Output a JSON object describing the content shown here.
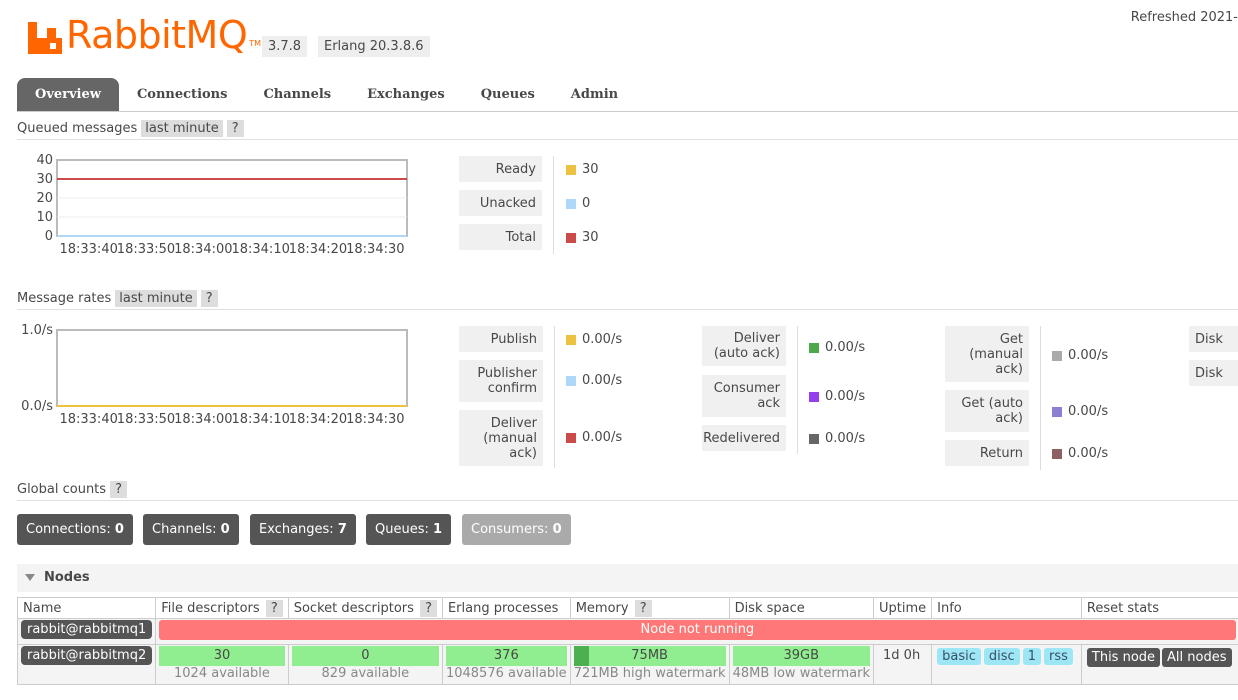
{
  "header": {
    "logo_text": "RabbitMQ",
    "logo_tm": "TM",
    "version": "3.7.8",
    "erlang": "Erlang 20.3.8.6",
    "refreshed": "Refreshed 2021-"
  },
  "tabs": [
    "Overview",
    "Connections",
    "Channels",
    "Exchanges",
    "Queues",
    "Admin"
  ],
  "queued": {
    "title": "Queued messages",
    "range": "last minute",
    "help": "?",
    "legend": [
      {
        "label": "Ready",
        "value": "30",
        "color": "#edc240"
      },
      {
        "label": "Unacked",
        "value": "0",
        "color": "#afd8f8"
      },
      {
        "label": "Total",
        "value": "30",
        "color": "#cb4b4b"
      }
    ]
  },
  "rates": {
    "title": "Message rates",
    "range": "last minute",
    "help": "?",
    "col1": [
      {
        "label": "Publish",
        "value": "0.00/s",
        "color": "#edc240"
      },
      {
        "label": "Publisher confirm",
        "value": "0.00/s",
        "color": "#afd8f8"
      },
      {
        "label": "Deliver (manual ack)",
        "value": "0.00/s",
        "color": "#cb4b4b"
      }
    ],
    "col2": [
      {
        "label": "Deliver (auto ack)",
        "value": "0.00/s",
        "color": "#4da74d"
      },
      {
        "label": "Consumer ack",
        "value": "0.00/s",
        "color": "#9440ed"
      },
      {
        "label": "Redelivered",
        "value": "0.00/s",
        "color": "#666666"
      }
    ],
    "col3": [
      {
        "label": "Get (manual ack)",
        "value": "0.00/s",
        "color": "#aaaaaa"
      },
      {
        "label": "Get (auto ack)",
        "value": "0.00/s",
        "color": "#8a7fd0"
      },
      {
        "label": "Return",
        "value": "0.00/s",
        "color": "#8c6161"
      }
    ],
    "col4": [
      "Disk",
      "Disk"
    ]
  },
  "chart_data": [
    {
      "type": "line",
      "title": "Queued messages",
      "x": [
        "18:33:40",
        "18:33:50",
        "18:34:00",
        "18:34:10",
        "18:34:20",
        "18:34:30"
      ],
      "y_ticks": [
        "40",
        "30",
        "20",
        "10",
        "0"
      ],
      "ylim": [
        0,
        40
      ],
      "series": [
        {
          "name": "Ready",
          "values": [
            30,
            30,
            30,
            30,
            30,
            30
          ]
        },
        {
          "name": "Unacked",
          "values": [
            0,
            0,
            0,
            0,
            0,
            0
          ]
        },
        {
          "name": "Total",
          "values": [
            30,
            30,
            30,
            30,
            30,
            30
          ]
        }
      ]
    },
    {
      "type": "line",
      "title": "Message rates",
      "x": [
        "18:33:40",
        "18:33:50",
        "18:34:00",
        "18:34:10",
        "18:34:20",
        "18:34:30"
      ],
      "y_ticks": [
        "1.0/s",
        "0.0/s"
      ],
      "ylim": [
        0,
        1
      ],
      "series": [
        {
          "name": "Publish",
          "values": [
            0,
            0,
            0,
            0,
            0,
            0
          ]
        }
      ]
    }
  ],
  "global": {
    "title": "Global counts",
    "help": "?",
    "counts": [
      {
        "label": "Connections:",
        "value": "0"
      },
      {
        "label": "Channels:",
        "value": "0"
      },
      {
        "label": "Exchanges:",
        "value": "7"
      },
      {
        "label": "Queues:",
        "value": "1"
      },
      {
        "label": "Consumers:",
        "value": "0"
      }
    ]
  },
  "nodes": {
    "title": "Nodes",
    "columns": [
      "Name",
      "File descriptors",
      "Socket descriptors",
      "Erlang processes",
      "Memory",
      "Disk space",
      "Uptime",
      "Info",
      "Reset stats"
    ],
    "help": "?",
    "rows": [
      {
        "name": "rabbit@rabbitmq1",
        "status": "Node not running"
      },
      {
        "name": "rabbit@rabbitmq2",
        "fd": "30",
        "fd_sub": "1024 available",
        "fd_fill": 0.03,
        "sd": "0",
        "sd_sub": "829 available",
        "sd_fill": 0.0,
        "ep": "376",
        "ep_sub": "1048576 available",
        "ep_fill": 0.0004,
        "mem": "75MB",
        "mem_sub": "721MB high watermark",
        "mem_fill": 0.1,
        "disk": "39GB",
        "disk_sub": "48MB low watermark",
        "disk_fill": 1.0,
        "uptime": "1d 0h",
        "info": [
          "basic",
          "disc",
          "1",
          "rss"
        ],
        "reset": [
          "This node",
          "All nodes"
        ]
      }
    ]
  }
}
